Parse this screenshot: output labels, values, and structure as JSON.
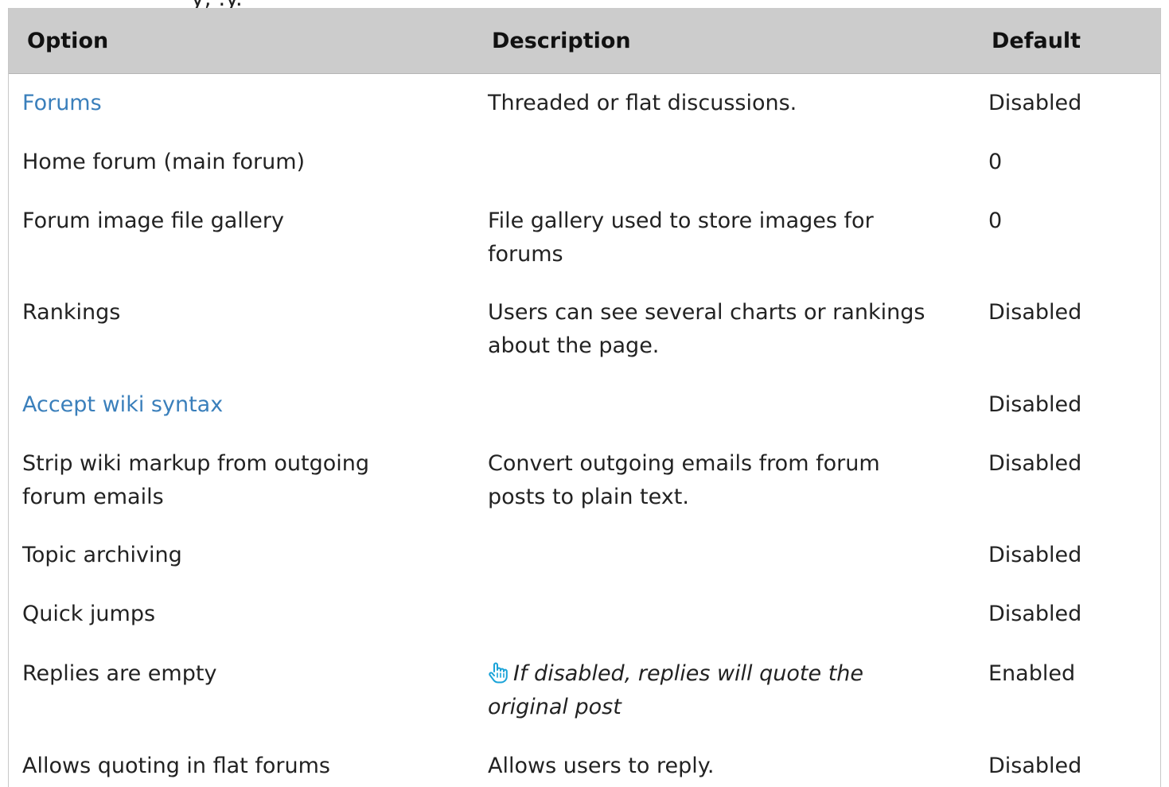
{
  "top_fragment": "y, .y.",
  "table": {
    "headers": {
      "option": "Option",
      "description": "Description",
      "default": "Default"
    },
    "rows": [
      {
        "option": "Forums",
        "option_is_link": true,
        "description": "Threaded or flat discussions.",
        "default": "Disabled"
      },
      {
        "option": "Home forum (main forum)",
        "description": "",
        "default": "0"
      },
      {
        "option": "Forum image file gallery",
        "description": "File gallery used to store images for forums",
        "default": "0"
      },
      {
        "option": "Rankings",
        "description": "Users can see several charts or rankings about the page.",
        "default": "Disabled"
      },
      {
        "option": "Accept wiki syntax",
        "option_is_link": true,
        "description": "",
        "default": "Disabled"
      },
      {
        "option": "Strip wiki markup from outgoing forum emails",
        "description": "Convert outgoing emails from forum posts to plain text.",
        "default": "Disabled"
      },
      {
        "option": "Topic archiving",
        "description": "",
        "default": "Disabled"
      },
      {
        "option": "Quick jumps",
        "description": "",
        "default": "Disabled"
      },
      {
        "option": "Replies are empty",
        "description": "If disabled, replies will quote the original post",
        "description_icon": "pointing-hand-icon",
        "default": "Enabled"
      },
      {
        "option": "Allows quoting in flat forums",
        "description": "Allows users to reply.",
        "default": "Disabled"
      }
    ]
  },
  "colors": {
    "link": "#3a7fbb",
    "header_bg": "#cccccc",
    "hint_icon": "#1aa3d8"
  }
}
